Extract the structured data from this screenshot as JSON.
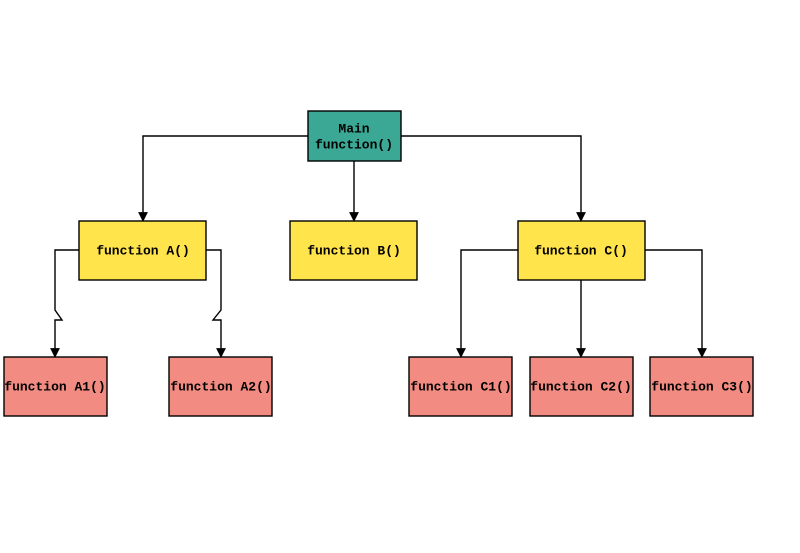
{
  "nodes": {
    "root": {
      "line1": "Main",
      "line2": "function()"
    },
    "a": {
      "label": "function A()"
    },
    "b": {
      "label": "function B()"
    },
    "c": {
      "label": "function C()"
    },
    "a1": {
      "label": "function A1()"
    },
    "a2": {
      "label": "function A2()"
    },
    "c1": {
      "label": "function C1()"
    },
    "c2": {
      "label": "function C2()"
    },
    "c3": {
      "label": "function C3()"
    }
  },
  "colors": {
    "root": "#3aa895",
    "mid": "#ffe44b",
    "leaf": "#f28b82"
  }
}
